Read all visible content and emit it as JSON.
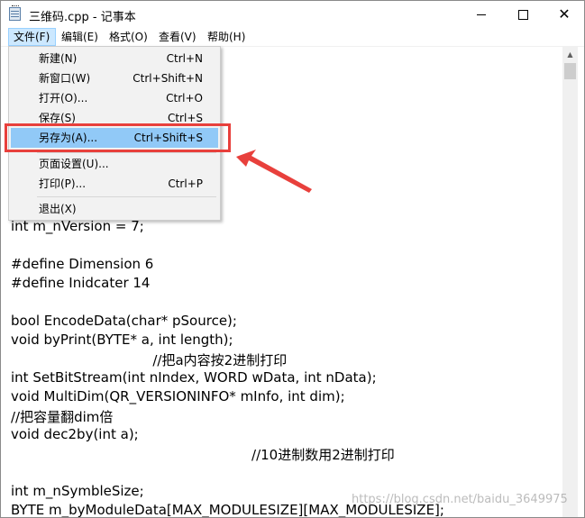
{
  "window": {
    "title": "三维码.cpp - 记事本",
    "controls": {
      "minimize": "minimize",
      "maximize": "maximize",
      "close": "✕"
    }
  },
  "menubar": {
    "items": [
      {
        "label": "文件(F)",
        "active": true
      },
      {
        "label": "编辑(E)"
      },
      {
        "label": "格式(O)"
      },
      {
        "label": "查看(V)"
      },
      {
        "label": "帮助(H)"
      }
    ]
  },
  "file_menu": {
    "items": [
      {
        "label": "新建(N)",
        "shortcut": "Ctrl+N"
      },
      {
        "label": "新窗口(W)",
        "shortcut": "Ctrl+Shift+N"
      },
      {
        "label": "打开(O)...",
        "shortcut": "Ctrl+O"
      },
      {
        "label": "保存(S)",
        "shortcut": "Ctrl+S"
      },
      {
        "label": "另存为(A)...",
        "shortcut": "Ctrl+Shift+S",
        "highlighted": true
      },
      {
        "label": "页面设置(U)...",
        "shortcut": ""
      },
      {
        "label": "打印(P)...",
        "shortcut": "Ctrl+P"
      },
      {
        "label": "退出(X)",
        "shortcut": ""
      }
    ]
  },
  "editor": {
    "lines": [
      "int m_nVersion = 7;",
      "#define Dimension 6",
      "#define Inidcater 14",
      "bool EncodeData(char* pSource);",
      "void byPrint(BYTE* a, int length);",
      "                                 //把a内容按2进制打印",
      "int SetBitStream(int nIndex, WORD wData, int nData);",
      "void MultiDim(QR_VERSIONINFO* mInfo, int dim);",
      "//把容量翻dim倍",
      "void dec2by(int a);",
      "                                                        //10进制数用2进制打印",
      "int m_nSymbleSize;",
      "BYTE m_byModuleData[MAX_MODULESIZE][MAX_MODULESIZE];"
    ]
  },
  "annotations": {
    "highlight_color": "#e8403c",
    "watermark": "https://blog.csdn.net/baidu_3649975"
  },
  "colors": {
    "menu_highlight": "#91c9f7",
    "menubar_active": "#cce8ff",
    "annotation_red": "#e8403c"
  }
}
